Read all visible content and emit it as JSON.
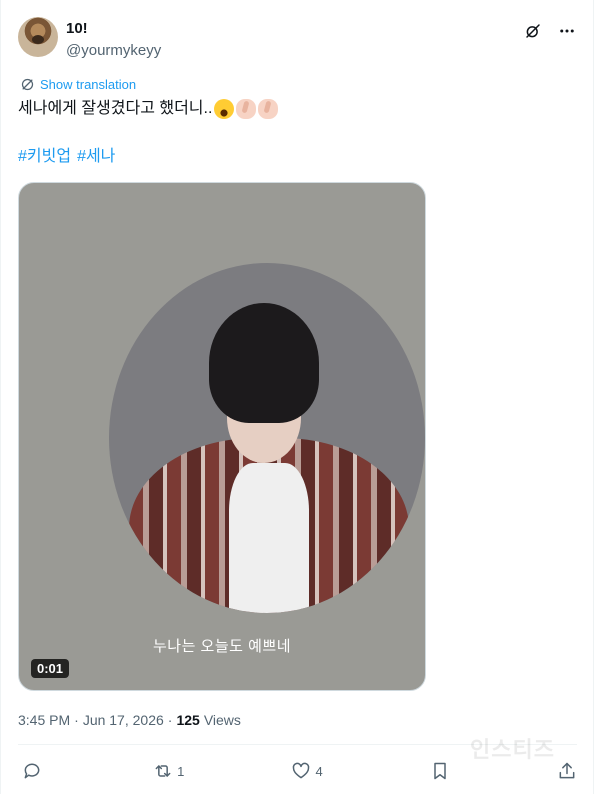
{
  "user": {
    "display_name": "10!",
    "handle": "@yourmykeyy",
    "avatar_icon": "dog-avatar"
  },
  "header": {
    "grok_icon": "grok-icon",
    "more_icon": "more-icon"
  },
  "translate": {
    "label": "Show translation"
  },
  "tweet": {
    "text": "세나에게 잘생겼다고 했더니.."
  },
  "hashtags": [
    "#키빗업",
    "#세나"
  ],
  "media": {
    "caption": "누나는 오늘도 예쁘네",
    "duration": "0:01"
  },
  "meta": {
    "time": "3:45 PM",
    "separator1": "·",
    "date": "Jun 17, 2026",
    "separator2": "·",
    "views_count": "125",
    "views_label": "Views"
  },
  "actions": {
    "reply_count": "",
    "retweet_count": "1",
    "like_count": "4"
  },
  "watermark": "인스티즈",
  "colors": {
    "accent": "#1d9bf0",
    "muted": "#536471",
    "text": "#0f1419"
  }
}
